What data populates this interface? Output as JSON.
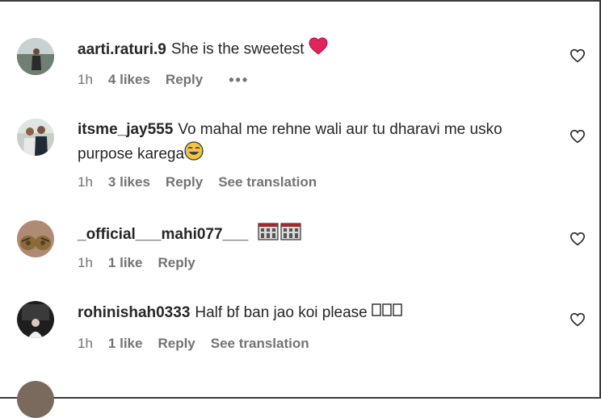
{
  "comments": [
    {
      "username": "aarti.raturi.9",
      "text": "She is the sweetest",
      "emoji": "heart-emoji",
      "time": "1h",
      "likes": "4 likes",
      "reply": "Reply",
      "more": "•••"
    },
    {
      "username": "itsme_jay555",
      "text": "Vo mahal me rehne wali aur tu dharavi me usko purpose karega",
      "emoji": "laughing-tears-emoji",
      "time": "1h",
      "likes": "3 likes",
      "reply": "Reply",
      "translation": "See translation"
    },
    {
      "username": "_official___mahi077___",
      "text": "",
      "emoji": "building-emoji",
      "time": "1h",
      "likes": "1 like",
      "reply": "Reply"
    },
    {
      "username": "rohinishah0333",
      "text": "Half bf ban jao koi please",
      "emoji": "unsupported-glyph-boxes",
      "time": "1h",
      "likes": "1 like",
      "reply": "Reply",
      "translation": "See translation"
    }
  ],
  "icons": {
    "like": "heart-outline-icon"
  },
  "colors": {
    "text": "#262626",
    "meta": "#737373",
    "heart_emoji": "#e0245e"
  }
}
